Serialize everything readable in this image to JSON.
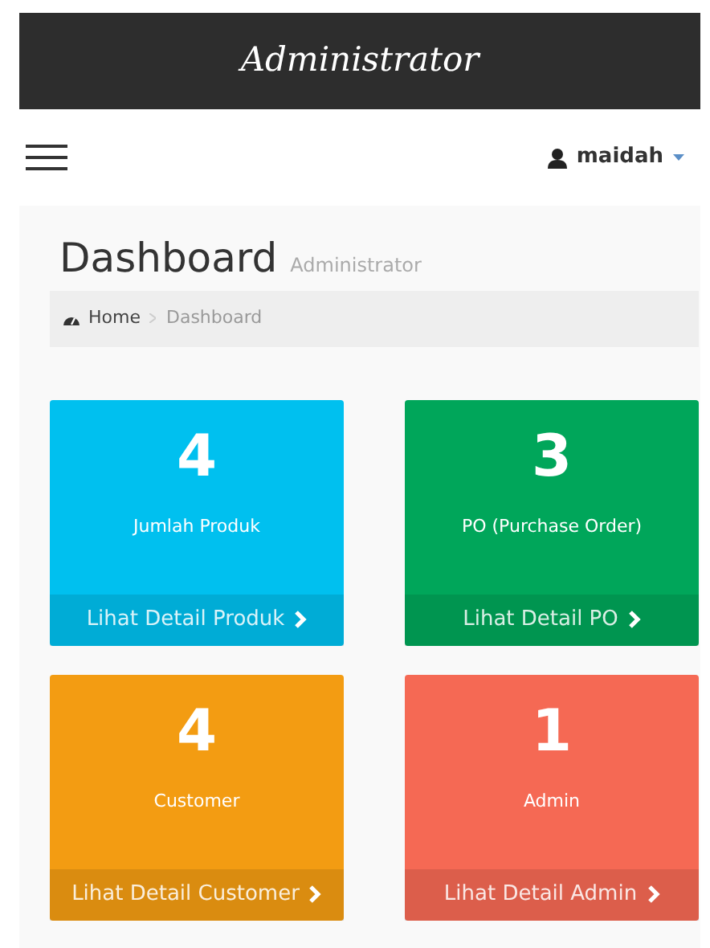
{
  "header": {
    "title": "Administrator"
  },
  "navbar": {
    "user": "maidah"
  },
  "page": {
    "title": "Dashboard",
    "subtitle": "Administrator"
  },
  "breadcrumb": [
    {
      "label": "Home",
      "kind": "home"
    },
    {
      "label": "Dashboard",
      "kind": "current"
    }
  ],
  "tiles": [
    {
      "count": "4",
      "label": "Jumlah Produk",
      "link": "Lihat Detail Produk",
      "color": "#00c0ef"
    },
    {
      "count": "3",
      "label": "PO (Purchase Order)",
      "link": "Lihat Detail PO",
      "color": "#00a65a"
    },
    {
      "count": "4",
      "label": "Customer",
      "link": "Lihat Detail Customer",
      "color": "#f39c12"
    },
    {
      "count": "1",
      "label": "Admin",
      "link": "Lihat Detail Admin",
      "color": "#f56954"
    }
  ]
}
